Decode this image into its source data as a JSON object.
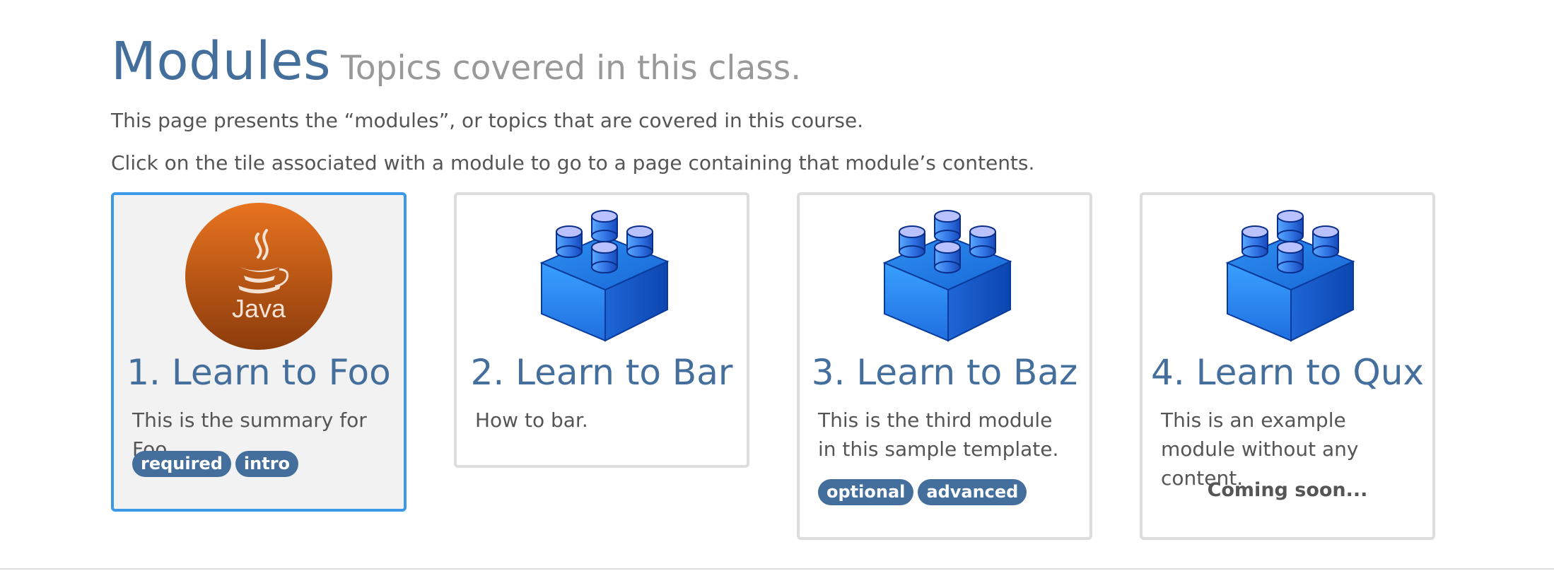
{
  "page": {
    "title": "Modules",
    "subtitle": "Topics covered in this class.",
    "intro_lines": [
      "This page presents the “modules”, or topics that are covered in this course.",
      "Click on the tile associated with a module to go to a page containing that module’s contents."
    ]
  },
  "modules": [
    {
      "title": "1. Learn to Foo",
      "summary": "This is the summary for Foo",
      "icon": "java-logo-icon",
      "icon_text": "Java",
      "tags": [
        "required",
        "intro"
      ],
      "selected": true
    },
    {
      "title": "2. Learn to Bar",
      "summary": "How to bar.",
      "icon": "building-block-icon",
      "tags": []
    },
    {
      "title": "3. Learn to Baz",
      "summary": "This is the third module in this sample template.",
      "icon": "building-block-icon",
      "tags": [
        "optional",
        "advanced"
      ]
    },
    {
      "title": "4. Learn to Qux",
      "summary": "This is an example module without any content.",
      "icon": "building-block-icon",
      "tags": [],
      "status": "Coming soon..."
    }
  ],
  "colors": {
    "title": "#446e9b",
    "tag_background": "#446e9b",
    "selected_border": "#3b99e7",
    "selected_background": "#f2f2f2",
    "tile_border": "#dddddd"
  }
}
